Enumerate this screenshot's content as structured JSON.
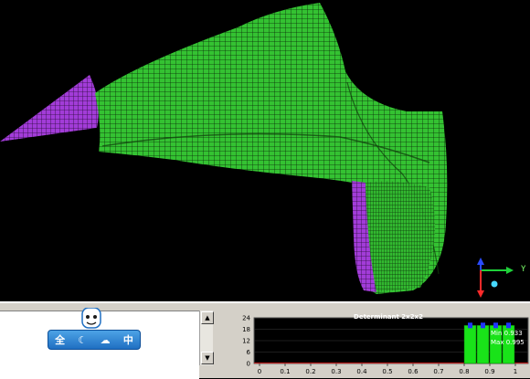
{
  "viewport": {
    "axis_y_label": "Y",
    "colors": {
      "background": "#000000",
      "mesh_main": "#34c232",
      "mesh_inlet": "#a23cd8",
      "axis_y": "#1fd13a",
      "axis_x": "#2a4bff",
      "axis_z": "#ff2a2a"
    }
  },
  "ime_toolbar": {
    "label_full": "全",
    "label_chinese": "中",
    "icons": [
      "moon-icon",
      "cloud-icon",
      "mascot-icon"
    ]
  },
  "histogram": {
    "title": "Determinant 2x2x2",
    "min_label": "Min 0.933",
    "max_label": "Max 0.995",
    "colors": {
      "background": "#000000",
      "bar": "#19e319",
      "marker": "#2035ff",
      "baseline": "#d02020"
    }
  },
  "chart_data": {
    "type": "bar",
    "title": "Determinant 2x2x2",
    "x": [
      0.825,
      0.875,
      0.925,
      0.975
    ],
    "values": [
      20,
      20,
      20,
      20
    ],
    "xlim": [
      0,
      1
    ],
    "ylim": [
      0,
      24
    ],
    "xticks": [
      "0",
      "0.1",
      "0.2",
      "0.3",
      "0.4",
      "0.5",
      "0.6",
      "0.7",
      "0.8",
      "0.9",
      "1"
    ],
    "yticks": [
      "0",
      "6",
      "12",
      "18",
      "24"
    ],
    "grid": true
  }
}
